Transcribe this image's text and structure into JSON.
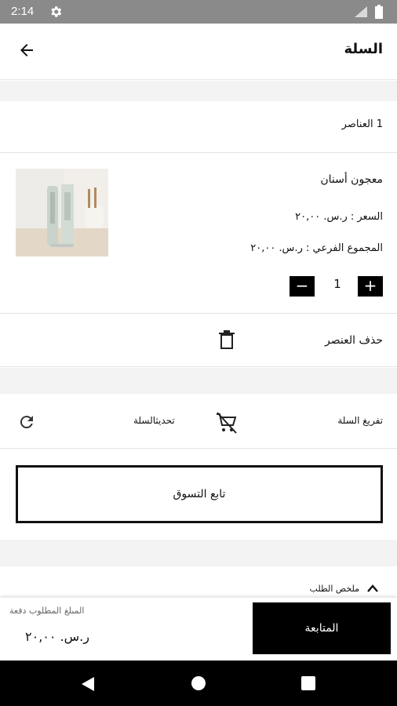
{
  "status_bar": {
    "time": "2:14"
  },
  "app_bar": {
    "title": "السلة"
  },
  "cart": {
    "items_count": "1 العناصر",
    "item": {
      "name": "معجون أسنان",
      "price": "السعر : ر.س. ٢٠,٠٠",
      "subtotal": "المجموع الفرعي : ر.س. ٢٠,٠٠",
      "quantity": "1",
      "minus": "−",
      "plus": "+"
    },
    "remove_label": "حذف العنصر",
    "empty_cart": "تفريغ السلة",
    "update_cart": "تحديثالسلة",
    "continue_shopping": "تابع التسوق"
  },
  "summary": {
    "label": "ملخص الطلب"
  },
  "footer": {
    "amount_due_label": "المبلغ المطلوب دفعة",
    "amount_due_value": "ر.س. ٢٠,٠٠",
    "checkout": "المتابعة"
  },
  "icons": {
    "back": "arrow-left-icon",
    "trash": "trash-icon",
    "refresh": "refresh-icon",
    "remove_cart": "cart-remove-icon",
    "chevron": "chevron-up-icon"
  }
}
